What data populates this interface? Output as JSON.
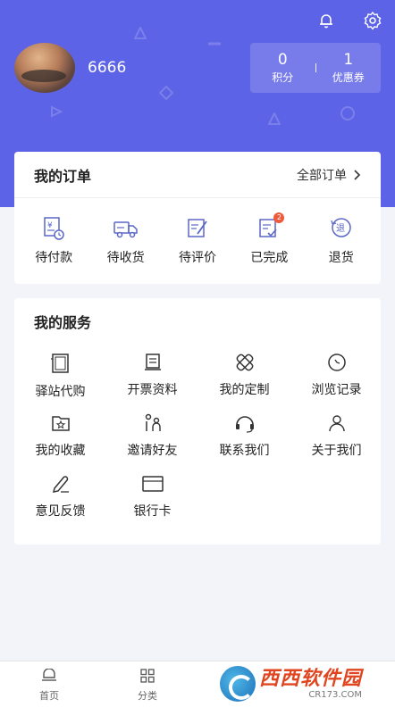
{
  "profile": {
    "username": "6666",
    "avatar_icon": "avatar-photo-icon"
  },
  "stats": [
    {
      "value": "0",
      "label": "积分"
    },
    {
      "value": "1",
      "label": "优惠券"
    }
  ],
  "top_icons": [
    "bell-icon",
    "settings-icon"
  ],
  "orders": {
    "title": "我的订单",
    "all_label": "全部订单",
    "items": [
      {
        "label": "待付款",
        "icon": "payment-icon"
      },
      {
        "label": "待收货",
        "icon": "delivery-truck-icon"
      },
      {
        "label": "待评价",
        "icon": "review-icon"
      },
      {
        "label": "已完成",
        "icon": "completed-icon",
        "badge": "2"
      },
      {
        "label": "退货",
        "icon": "return-icon"
      }
    ]
  },
  "services": {
    "title": "我的服务",
    "items": [
      {
        "label": "驿站代购",
        "icon": "purchase-icon"
      },
      {
        "label": "开票资料",
        "icon": "invoice-icon"
      },
      {
        "label": "我的定制",
        "icon": "custom-icon"
      },
      {
        "label": "浏览记录",
        "icon": "history-icon"
      },
      {
        "label": "我的收藏",
        "icon": "favorites-icon"
      },
      {
        "label": "邀请好友",
        "icon": "invite-icon"
      },
      {
        "label": "联系我们",
        "icon": "headset-icon"
      },
      {
        "label": "关于我们",
        "icon": "user-icon"
      },
      {
        "label": "意见反馈",
        "icon": "feedback-icon"
      },
      {
        "label": "银行卡",
        "icon": "bank-card-icon"
      }
    ]
  },
  "bottom_nav": [
    {
      "label": "首页",
      "icon": "home-icon"
    },
    {
      "label": "分类",
      "icon": "category-icon"
    }
  ],
  "watermark": {
    "main": "西西软件园",
    "sub": "CR173.COM"
  },
  "colors": {
    "header": "#5d63e6",
    "badge": "#ee5a3b"
  }
}
